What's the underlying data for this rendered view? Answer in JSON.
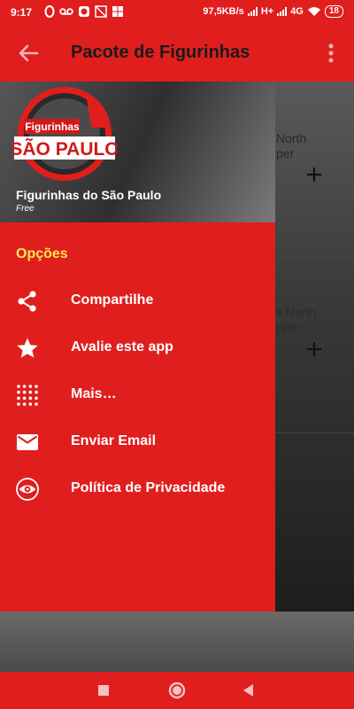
{
  "status_bar": {
    "time": "9:17",
    "speed": "97,5KB/s",
    "network_type": "H+",
    "network_4g": "4G",
    "battery": "18"
  },
  "app_bar": {
    "title": "Pacote de Figurinhas",
    "back_icon": "arrow-back-icon",
    "more_icon": "more-vert-icon"
  },
  "background_cards": [
    {
      "text_line1": "North",
      "text_line2": "per"
    },
    {
      "text_line1": "s North",
      "text_line2": "oper"
    }
  ],
  "drawer": {
    "logo": {
      "word1": "Figurinhas",
      "word2": "SÃO PAULO"
    },
    "header_name": "Figurinhas do São Paulo",
    "header_sub": "Free",
    "section_title": "Opções",
    "items": [
      {
        "label": "Compartilhe",
        "icon": "share-icon"
      },
      {
        "label": "Avalie este app",
        "icon": "star-icon"
      },
      {
        "label": "Mais…",
        "icon": "grid-dots-icon"
      },
      {
        "label": "Enviar Email",
        "icon": "email-icon"
      },
      {
        "label": "Política de Privacidade",
        "icon": "privacy-eye-icon"
      }
    ]
  },
  "nav_bar": {
    "recent_icon": "square-icon",
    "home_icon": "circle-icon",
    "back_icon": "triangle-back-icon"
  },
  "colors": {
    "primary_red": "#e01e1e",
    "accent_yellow": "#ffe94a",
    "text_dark": "#1a1a1a"
  }
}
